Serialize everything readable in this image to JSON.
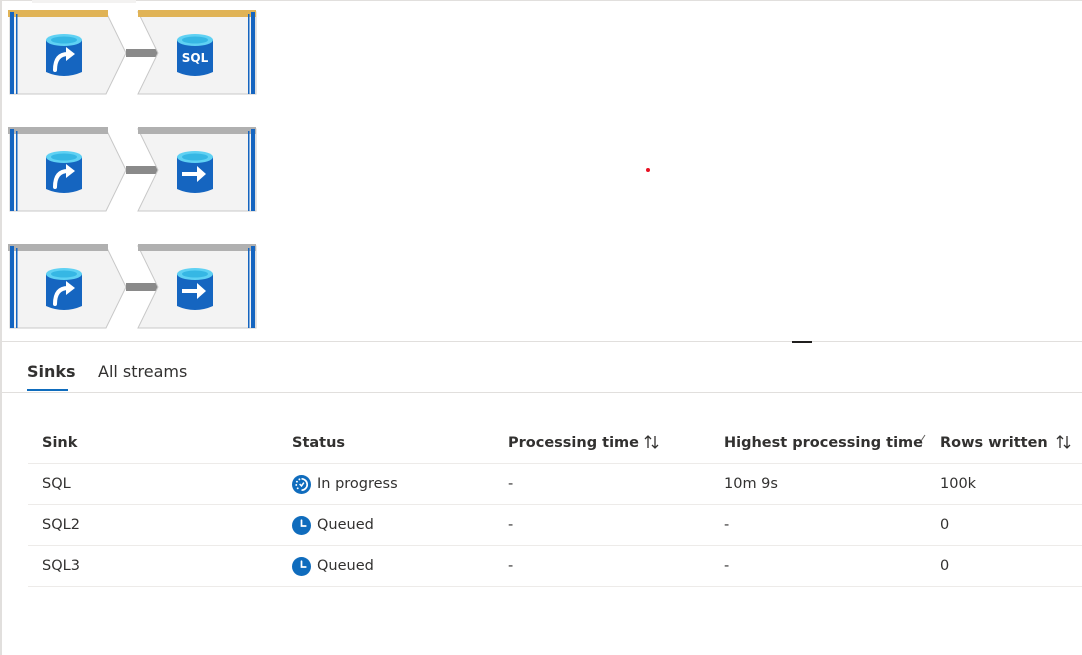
{
  "canvas": {
    "flows": [
      {
        "source_icon": "database-arrow-icon",
        "sink_icon": "sql-database-icon",
        "sink_badge": "SQL",
        "bar_color": "#e0b356"
      },
      {
        "source_icon": "database-arrow-icon",
        "sink_icon": "database-arrow-right-icon",
        "sink_badge": "",
        "bar_color": "#b0b0b0"
      },
      {
        "source_icon": "database-arrow-icon",
        "sink_icon": "database-arrow-right-icon",
        "sink_badge": "",
        "bar_color": "#b0b0b0"
      }
    ]
  },
  "tabs": {
    "sinks": "Sinks",
    "all_streams": "All streams"
  },
  "table": {
    "headers": {
      "sink": "Sink",
      "status": "Status",
      "processing_time": "Processing time",
      "highest_processing_time": "Highest processing time",
      "rows_written": "Rows written"
    },
    "rows": [
      {
        "sink": "SQL",
        "status": "In progress",
        "status_icon": "in-progress-icon",
        "processing_time": "-",
        "highest_processing_time": "10m 9s",
        "rows_written": "100k"
      },
      {
        "sink": "SQL2",
        "status": "Queued",
        "status_icon": "clock-icon",
        "processing_time": "-",
        "highest_processing_time": "-",
        "rows_written": "0"
      },
      {
        "sink": "SQL3",
        "status": "Queued",
        "status_icon": "clock-icon",
        "processing_time": "-",
        "highest_processing_time": "-",
        "rows_written": "0"
      }
    ]
  },
  "colors": {
    "accent": "#0f6cbd",
    "status_blue": "#0f6cbd",
    "node_border_blue": "#1565c0",
    "connector": "#8a8a8a"
  }
}
